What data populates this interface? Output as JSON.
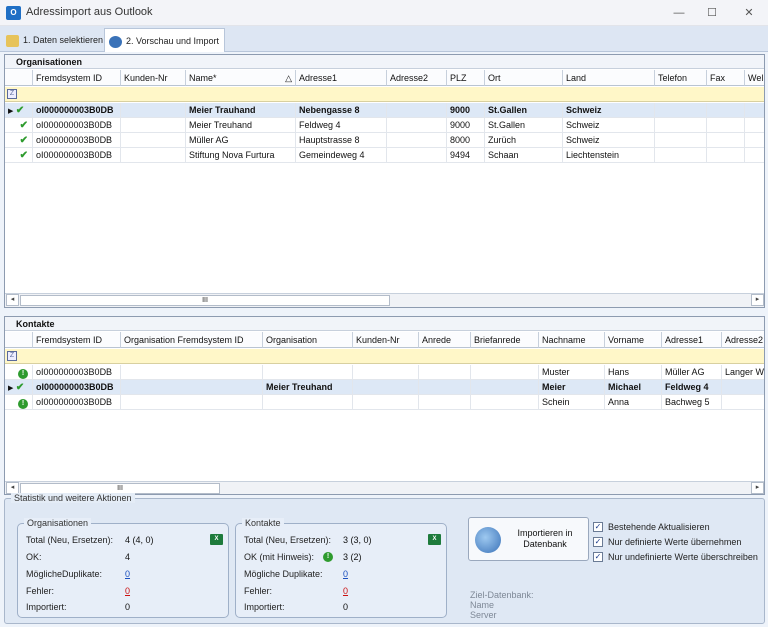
{
  "window": {
    "title": "Adressimport aus Outlook",
    "icon_text": "O"
  },
  "tabs": [
    {
      "label": "1. Daten selektieren"
    },
    {
      "label": "2. Vorschau und Import"
    }
  ],
  "organisations": {
    "title": "Organisationen",
    "columns": [
      "Fremdsystem ID",
      "Kunden-Nr",
      "Name*",
      "Adresse1",
      "Adresse2",
      "PLZ",
      "Ort",
      "Land",
      "Telefon",
      "Fax",
      "Wel"
    ],
    "sort_indicator": "△",
    "rows": [
      {
        "id": "oI000000003B0DB",
        "kunden": "",
        "name": "Meier Trauhand",
        "adresse1": "Nebengasse 8",
        "adresse2": "",
        "plz": "9000",
        "ort": "St.Gallen",
        "land": "Schweiz"
      },
      {
        "id": "oI000000003B0DB",
        "kunden": "",
        "name": "Meier Treuhand",
        "adresse1": "Feldweg 4",
        "adresse2": "",
        "plz": "9000",
        "ort": "St.Gallen",
        "land": "Schweiz"
      },
      {
        "id": "oI000000003B0DB",
        "kunden": "",
        "name": "Müller AG",
        "adresse1": "Hauptstrasse 8",
        "adresse2": "",
        "plz": "8000",
        "ort": "Zurüch",
        "land": "Schweiz"
      },
      {
        "id": "oI000000003B0DB",
        "kunden": "",
        "name": "Stiftung Nova Furtura",
        "adresse1": "Gemeindeweg 4",
        "adresse2": "",
        "plz": "9494",
        "ort": "Schaan",
        "land": "Liechtenstein"
      }
    ],
    "scroll_grip": "III"
  },
  "contacts": {
    "title": "Kontakte",
    "columns": [
      "Fremdsystem ID",
      "Organisation Fremdsystem ID",
      "Organisation",
      "Kunden-Nr",
      "Anrede",
      "Briefanrede",
      "Nachname",
      "Vorname",
      "Adresse1",
      "Adresse2"
    ],
    "rows": [
      {
        "status": "info",
        "id": "oI000000003B0DB",
        "org_id": "",
        "org": "",
        "kunden": "",
        "anrede": "",
        "brief": "",
        "nachname": "Muster",
        "vorname": "Hans",
        "adresse1": "Müller AG",
        "adresse2": "Langer W"
      },
      {
        "status": "check",
        "id": "oI000000003B0DB",
        "org_id": "",
        "org": "Meier Treuhand",
        "kunden": "",
        "anrede": "",
        "brief": "",
        "nachname": "Meier",
        "vorname": "Michael",
        "adresse1": "Feldweg 4",
        "adresse2": ""
      },
      {
        "status": "info",
        "id": "oI000000003B0DB",
        "org_id": "",
        "org": "",
        "kunden": "",
        "anrede": "",
        "brief": "",
        "nachname": "Schein",
        "vorname": "Anna",
        "adresse1": "Bachweg 5",
        "adresse2": ""
      }
    ],
    "scroll_grip": "III"
  },
  "stats": {
    "legend": "Statistik und weitere Aktionen",
    "org": {
      "legend": "Organisationen",
      "total_label": "Total (Neu, Ersetzen):",
      "total_value": "4 (4, 0)",
      "ok_label": "OK:",
      "ok_value": "4",
      "dup_label": "MöglicheDuplikate:",
      "dup_value": "0",
      "err_label": "Fehler:",
      "err_value": "0",
      "imp_label": "Importiert:",
      "imp_value": "0"
    },
    "contacts": {
      "legend": "Kontakte",
      "total_label": "Total (Neu, Ersetzen):",
      "total_value": "3 (3, 0)",
      "ok_label": "OK (mit Hinweis):",
      "ok_value": "3 (2)",
      "dup_label": "Mögliche Duplikate:",
      "dup_value": "0",
      "err_label": "Fehler:",
      "err_value": "0",
      "imp_label": "Importiert:",
      "imp_value": "0"
    },
    "import_button": {
      "line1": "Importieren in",
      "line2": "Datenbank"
    },
    "options": [
      {
        "label": "Bestehende Aktualisieren",
        "checked": true
      },
      {
        "label": "Nur definierte Werte übernehmen",
        "checked": true
      },
      {
        "label": "Nur undefinierte Werte überschreiben",
        "checked": true
      }
    ],
    "target": {
      "label": "Ziel-Datenbank:",
      "name": "Name",
      "server": "Server"
    }
  }
}
